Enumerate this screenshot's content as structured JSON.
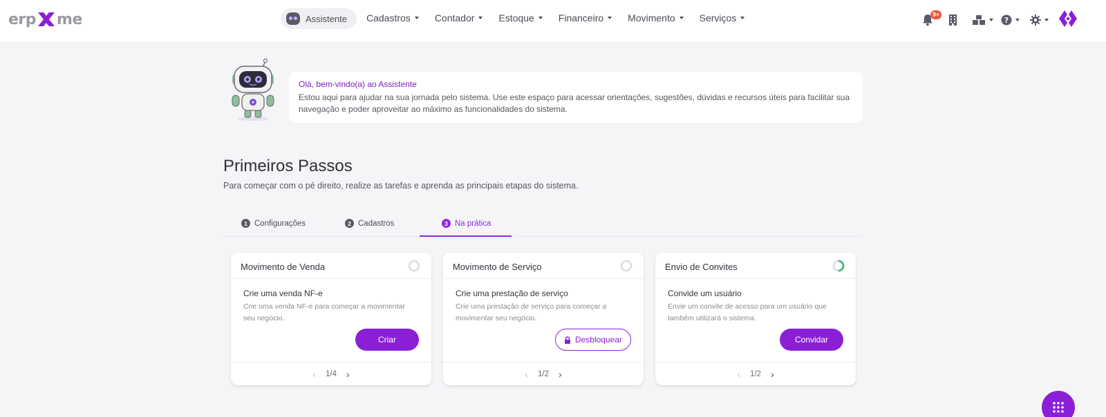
{
  "header": {
    "logo": {
      "text_left": "erp",
      "text_right": "me"
    },
    "assistant_label": "Assistente",
    "menu": [
      {
        "label": "Cadastros"
      },
      {
        "label": "Contador"
      },
      {
        "label": "Estoque"
      },
      {
        "label": "Financeiro"
      },
      {
        "label": "Movimento"
      },
      {
        "label": "Serviços"
      }
    ],
    "notifications_badge": "9+",
    "icons": [
      "bell-icon",
      "building-icon",
      "boxes-icon",
      "help-icon",
      "gear-icon",
      "brand-icon"
    ]
  },
  "welcome": {
    "title": "Olá, bem-vindo(a) ao Assistente",
    "text": "Estou aqui para ajudar na sua jornada pelo sistema. Use este espaço para acessar orientações, sugestões, dúvidas e recursos úteis para facilitar sua navegação e poder aproveitar ao máximo as funcionalidades do sistema."
  },
  "section": {
    "title": "Primeiros Passos",
    "subtitle": "Para começar com o pé direito, realize as tarefas e aprenda as principais etapas do sistema."
  },
  "tabs": [
    {
      "num": "1",
      "label": "Configurações"
    },
    {
      "num": "2",
      "label": "Cadastros"
    },
    {
      "num": "3",
      "label": "Na prática",
      "active": true
    }
  ],
  "cards": [
    {
      "title": "Movimento de Venda",
      "task_title": "Crie uma venda NF-e",
      "task_desc": "Crie uma venda NF-e para começar a movimentar seu negócio.",
      "button": "Criar",
      "pager": "1/4",
      "progress": 0
    },
    {
      "title": "Movimento de Serviço",
      "task_title": "Crie uma prestação de serviço",
      "task_desc": "Crie uma prestação de serviço para começar a movimentar seu negócio.",
      "button": "Desbloquear",
      "pager": "1/2",
      "progress": 0
    },
    {
      "title": "Envio de Convites",
      "task_title": "Convide um usuário",
      "task_desc": "Envie um convite de acesso para um usuário que também utilizará o sistema.",
      "button": "Convidar",
      "pager": "1/2",
      "progress": 0.5
    }
  ],
  "colors": {
    "accent": "#8a1fd6",
    "progress_green": "#2fb36a",
    "badge": "#e8553a"
  }
}
